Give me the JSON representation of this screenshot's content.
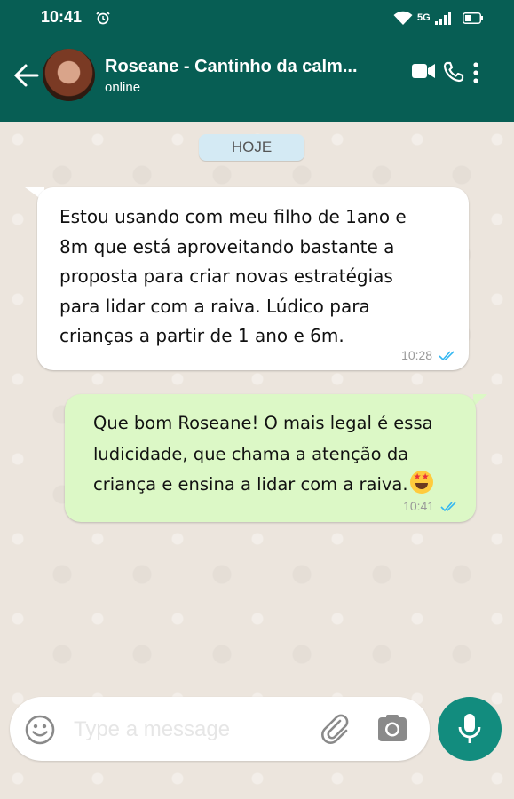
{
  "status_bar": {
    "time": "10:41",
    "network": "5G",
    "icons": [
      "alarm-icon",
      "wifi-icon",
      "signal-icon",
      "battery-icon"
    ]
  },
  "header": {
    "contact_name": "Roseane - Cantinho da calm...",
    "status": "online",
    "icons": [
      "back-arrow-icon",
      "avatar",
      "video-call-icon",
      "phone-call-icon",
      "more-menu-icon"
    ],
    "colors": {
      "header_bg": "#075e54",
      "header_text": "#ffffff"
    }
  },
  "chat": {
    "date_chip": "HOJE",
    "messages": [
      {
        "direction": "incoming",
        "text": "Estou usando com meu filho de 1ano e\n8m que está aproveitando bastante a\nproposta para criar novas estratégias\npara lidar com a raiva. Lúdico para\ncrianças a partir de 1 ano e 6m.",
        "time": "10:28",
        "ticks": "double-check-icon"
      },
      {
        "direction": "outgoing",
        "text": "Que bom Roseane! O mais legal é essa\nludicidade, que chama a atenção da\ncriança e ensina a lidar com a raiva.",
        "emoji": "star-struck-emoji",
        "time": "10:41",
        "ticks": "double-check-icon"
      }
    ],
    "colors": {
      "incoming_bg": "#ffffff",
      "outgoing_bg": "#dcf8c6",
      "read_tick": "#34b7f1",
      "chat_bg": "#ece5dd"
    }
  },
  "composer": {
    "placeholder": "Type a message",
    "value": "",
    "icons": [
      "emoji-icon",
      "attach-icon",
      "camera-icon",
      "mic-icon"
    ],
    "colors": {
      "mic_button_bg": "#128c7e"
    }
  }
}
